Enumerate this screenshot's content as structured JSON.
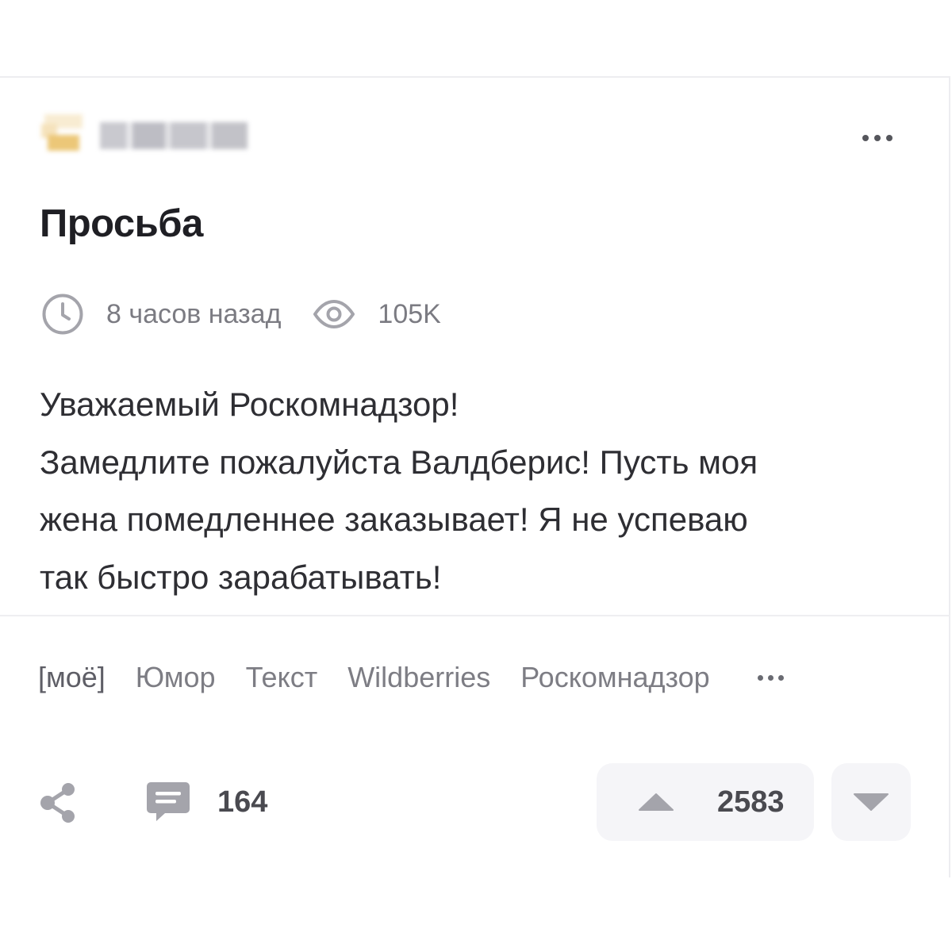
{
  "post": {
    "title": "Просьба",
    "time_ago": "8 часов назад",
    "views": "105K",
    "body_lines": [
      "Уважаемый Роскомнадзор!",
      "Замедлите пожалуйста Валдберис! Пусть моя",
      "жена помедленнее заказывает! Я не успеваю",
      "так быстро зарабатывать!"
    ]
  },
  "tags": [
    "[моё]",
    "Юмор",
    "Текст",
    "Wildberries",
    "Роскомнадзор"
  ],
  "actions": {
    "comments_count": "164",
    "rating": "2583"
  },
  "icons": {
    "menu": "more-horizontal-icon",
    "time": "clock-icon",
    "views": "eye-icon",
    "share": "share-icon",
    "comments": "comment-icon",
    "upvote": "triangle-up-icon",
    "downvote": "triangle-down-icon"
  },
  "colors": {
    "text": "#2e2e33",
    "muted": "#7b7b82",
    "icon": "#a4a4ab",
    "button_bg": "#f5f5f8"
  }
}
